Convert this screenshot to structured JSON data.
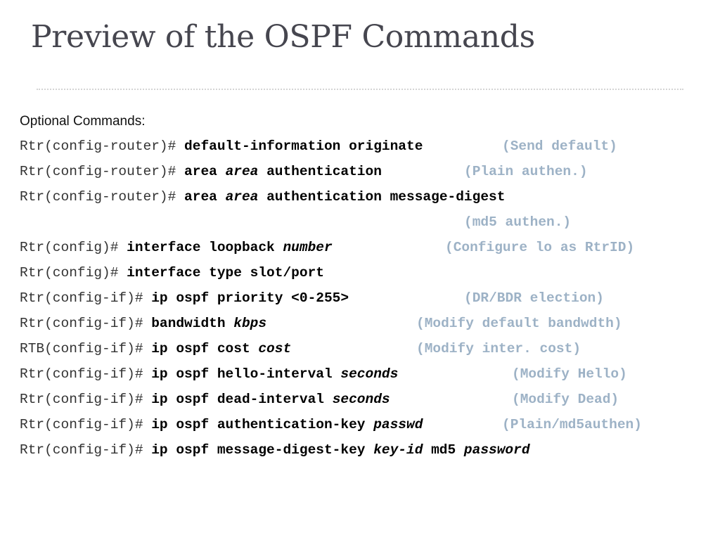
{
  "slide": {
    "title": "Preview of the OSPF Commands",
    "subheading": "Optional Commands:",
    "colors": {
      "title": "#46464f",
      "comment": "#9db2c6",
      "divider": "#d4d4d4"
    },
    "lines": [
      {
        "prompt": "Rtr(config-router)# ",
        "parts": [
          {
            "type": "kw",
            "text": "default-information originate"
          }
        ],
        "comment": "(Send default)"
      },
      {
        "prompt": "Rtr(config-router)# ",
        "parts": [
          {
            "type": "kw",
            "text": "area "
          },
          {
            "type": "arg",
            "text": "area"
          },
          {
            "type": "kw",
            "text": " authentication"
          }
        ],
        "comment": "(Plain authen.)"
      },
      {
        "prompt": "Rtr(config-router)# ",
        "parts": [
          {
            "type": "kw",
            "text": "area "
          },
          {
            "type": "arg",
            "text": "area"
          },
          {
            "type": "kw",
            "text": " authentication message-digest"
          }
        ],
        "comment": ""
      },
      {
        "prompt": "",
        "parts": [],
        "comment": "(md5 authen.)"
      },
      {
        "prompt": "Rtr(config)# ",
        "parts": [
          {
            "type": "kw",
            "text": "interface loopback "
          },
          {
            "type": "arg",
            "text": "number"
          }
        ],
        "comment": "(Configure lo as RtrID)"
      },
      {
        "prompt": "Rtr(config)# ",
        "parts": [
          {
            "type": "kw",
            "text": "interface type slot/port"
          }
        ],
        "comment": ""
      },
      {
        "prompt": "Rtr(config-if)# ",
        "parts": [
          {
            "type": "kw",
            "text": "ip ospf priority <0-255>"
          }
        ],
        "comment": "(DR/BDR election)"
      },
      {
        "prompt": "Rtr(config-if)# ",
        "parts": [
          {
            "type": "kw",
            "text": "bandwidth "
          },
          {
            "type": "arg",
            "text": "kbps"
          }
        ],
        "comment": "(Modify default bandwdth)"
      },
      {
        "prompt": "RTB(config-if)# ",
        "parts": [
          {
            "type": "kw",
            "text": "ip ospf cost "
          },
          {
            "type": "arg",
            "text": "cost"
          }
        ],
        "comment": "(Modify inter. cost)"
      },
      {
        "prompt": "Rtr(config-if)# ",
        "parts": [
          {
            "type": "kw",
            "text": "ip ospf hello-interval "
          },
          {
            "type": "arg",
            "text": "seconds"
          }
        ],
        "comment": "(Modify Hello)"
      },
      {
        "prompt": "Rtr(config-if)# ",
        "parts": [
          {
            "type": "kw",
            "text": "ip ospf dead-interval "
          },
          {
            "type": "arg",
            "text": "seconds"
          }
        ],
        "comment": "(Modify Dead)"
      },
      {
        "prompt": "Rtr(config-if)# ",
        "parts": [
          {
            "type": "kw",
            "text": "ip ospf authentication-key "
          },
          {
            "type": "arg",
            "text": "passwd"
          }
        ],
        "comment": "(Plain/md5authen)"
      },
      {
        "prompt": "Rtr(config-if)# ",
        "parts": [
          {
            "type": "kw",
            "text": "ip ospf message-digest-key "
          },
          {
            "type": "arg",
            "text": "key-id"
          },
          {
            "type": "kw",
            "text": " md5 "
          },
          {
            "type": "arg",
            "text": "password"
          }
        ],
        "comment": ""
      }
    ]
  }
}
